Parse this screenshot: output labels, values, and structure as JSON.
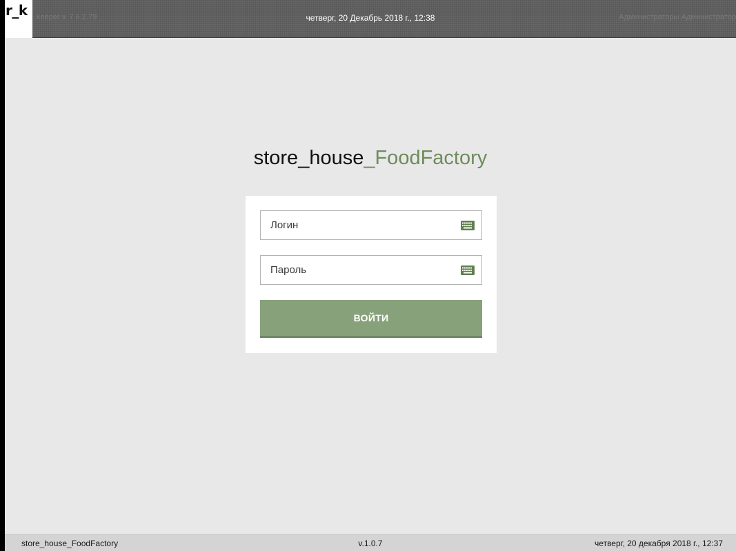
{
  "header": {
    "logo": "r_k",
    "version": "keeper v. 7.6.2.79",
    "datetime": "четверг, 20 Декабрь 2018 г., 12:38",
    "user": "Администраторы Администратор"
  },
  "app": {
    "title_main": "store_house",
    "title_accent": "_FoodFactory"
  },
  "login_form": {
    "login_placeholder": "Логин",
    "password_placeholder": "Пароль",
    "login_icon": "keyboard-icon",
    "password_icon": "keyboard-icon",
    "submit_label": "ВОЙТИ"
  },
  "status_bar": {
    "app_name": "store_house_FoodFactory",
    "version": "v.1.0.7",
    "datetime": "четверг, 20 декабря 2018 г., 12:37"
  },
  "colors": {
    "accent": "#6e8b5a",
    "button": "#87a27a",
    "icon": "#5f7f4f",
    "background": "#e8e8e8"
  }
}
